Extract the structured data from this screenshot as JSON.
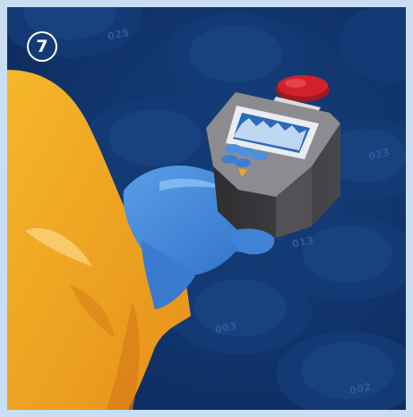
{
  "step_number": "7",
  "slot_labels": {
    "a": "025",
    "b": "023",
    "c": "013",
    "d": "003",
    "e": "002"
  },
  "colors": {
    "background": "#0f3167",
    "frame": "#c9ddf3",
    "suit": "#f2a81d",
    "glove": "#4b8fe0",
    "device_body": "#3a3a3d",
    "device_screen": "#2b6ab8",
    "alarm_button": "#d2202c"
  }
}
